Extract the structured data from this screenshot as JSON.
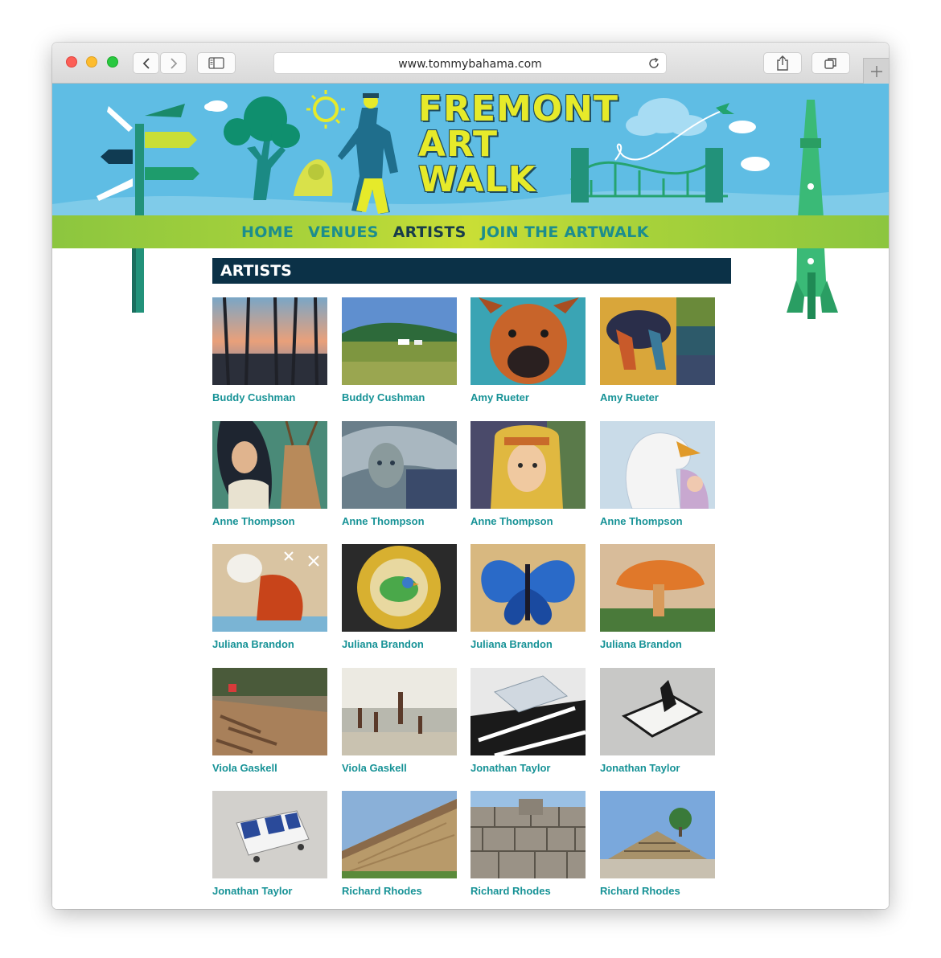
{
  "browser": {
    "url": "www.tommybahama.com",
    "back_icon": "chevron-left-icon",
    "forward_icon": "chevron-right-icon",
    "sidebar_icon": "sidebar-icon",
    "reload_icon": "reload-icon",
    "share_icon": "share-icon",
    "tabs_icon": "tabs-icon",
    "newtab_icon": "plus-icon"
  },
  "banner": {
    "title_lines": [
      "FREMONT",
      "ART",
      "WALK"
    ],
    "colors": {
      "sky": "#5fbde4",
      "grass": "#8cc63f",
      "title": "#e6ea2a",
      "nav_link": "#1c8d8d",
      "nav_active": "#173c4a"
    }
  },
  "nav": {
    "items": [
      {
        "label": "HOME",
        "active": false
      },
      {
        "label": "VENUES",
        "active": false
      },
      {
        "label": "ARTISTS",
        "active": true
      },
      {
        "label": "JOIN THE ARTWALK",
        "active": false
      }
    ]
  },
  "section": {
    "heading": "ARTISTS",
    "heading_bg": "#0b3147"
  },
  "artworks": [
    {
      "artist": "Buddy Cushman"
    },
    {
      "artist": "Buddy Cushman"
    },
    {
      "artist": "Amy Rueter"
    },
    {
      "artist": "Amy Rueter"
    },
    {
      "artist": "Anne Thompson"
    },
    {
      "artist": "Anne Thompson"
    },
    {
      "artist": "Anne Thompson"
    },
    {
      "artist": "Anne Thompson"
    },
    {
      "artist": "Juliana Brandon"
    },
    {
      "artist": "Juliana Brandon"
    },
    {
      "artist": "Juliana Brandon"
    },
    {
      "artist": "Juliana Brandon"
    },
    {
      "artist": "Viola Gaskell"
    },
    {
      "artist": "Viola Gaskell"
    },
    {
      "artist": "Jonathan Taylor"
    },
    {
      "artist": "Jonathan Taylor"
    },
    {
      "artist": "Jonathan Taylor"
    },
    {
      "artist": "Richard Rhodes"
    },
    {
      "artist": "Richard Rhodes"
    },
    {
      "artist": "Richard Rhodes"
    }
  ],
  "link_color": "#169296"
}
